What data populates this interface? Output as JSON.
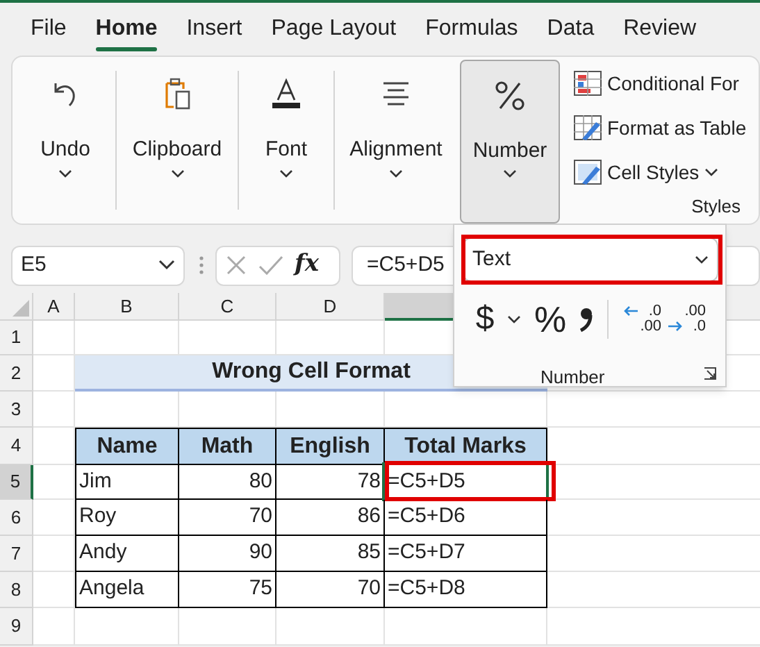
{
  "tabs": [
    {
      "label": "File",
      "selected": false
    },
    {
      "label": "Home",
      "selected": true
    },
    {
      "label": "Insert",
      "selected": false
    },
    {
      "label": "Page Layout",
      "selected": false
    },
    {
      "label": "Formulas",
      "selected": false
    },
    {
      "label": "Data",
      "selected": false
    },
    {
      "label": "Review",
      "selected": false
    }
  ],
  "ribbon": {
    "groups": [
      {
        "label": "Undo",
        "kind": "undo",
        "selected": false
      },
      {
        "label": "Clipboard",
        "kind": "clipboard",
        "selected": false
      },
      {
        "label": "Font",
        "kind": "font",
        "selected": false
      },
      {
        "label": "Alignment",
        "kind": "alignment",
        "selected": false
      },
      {
        "label": "Number",
        "kind": "number",
        "selected": true
      }
    ],
    "styles": {
      "items": [
        {
          "label": "Conditional For",
          "kind": "conditional"
        },
        {
          "label": "Format as Table",
          "kind": "table"
        },
        {
          "label": "Cell Styles",
          "kind": "cellstyles"
        }
      ],
      "label": "Styles"
    }
  },
  "formula_bar": {
    "name_box": "E5",
    "fx": "fx",
    "formula": "=C5+D5"
  },
  "number_panel": {
    "format": "Text",
    "highlighted": true,
    "currency": "$",
    "percent": "%",
    "decimals": [
      {
        "kind": "increase",
        "top": ".0",
        "bottom": ".00"
      },
      {
        "kind": "decrease",
        "top": ".00",
        "bottom": ".0"
      }
    ],
    "label": "Number"
  },
  "sheet": {
    "columns": [
      {
        "label": "A",
        "selected": false
      },
      {
        "label": "B",
        "selected": false
      },
      {
        "label": "C",
        "selected": false
      },
      {
        "label": "D",
        "selected": false
      },
      {
        "selected": true
      }
    ],
    "rows": [
      {
        "label": "1",
        "selected": false
      },
      {
        "label": "2",
        "selected": false
      },
      {
        "label": "3",
        "selected": false
      },
      {
        "label": "4",
        "selected": false
      },
      {
        "label": "5",
        "selected": true
      },
      {
        "label": "6",
        "selected": false
      },
      {
        "label": "7",
        "selected": false
      },
      {
        "label": "8",
        "selected": false
      },
      {
        "label": "9",
        "selected": false
      }
    ],
    "title": "Wrong Cell Format",
    "table": {
      "columns": [
        "Name",
        "Math",
        "English",
        "Total Marks"
      ],
      "rows": [
        {
          "cells": [
            "Jim",
            "80",
            "78",
            "=C5+D5"
          ],
          "selected": true,
          "highlighted": true
        },
        {
          "cells": [
            "Roy",
            "70",
            "86",
            "=C5+D6"
          ],
          "selected": false,
          "highlighted": false
        },
        {
          "cells": [
            "Andy",
            "90",
            "85",
            "=C5+D7"
          ],
          "selected": false,
          "highlighted": false
        },
        {
          "cells": [
            "Angela",
            "75",
            "70",
            "=C5+D8"
          ],
          "selected": false,
          "highlighted": false
        }
      ]
    }
  }
}
